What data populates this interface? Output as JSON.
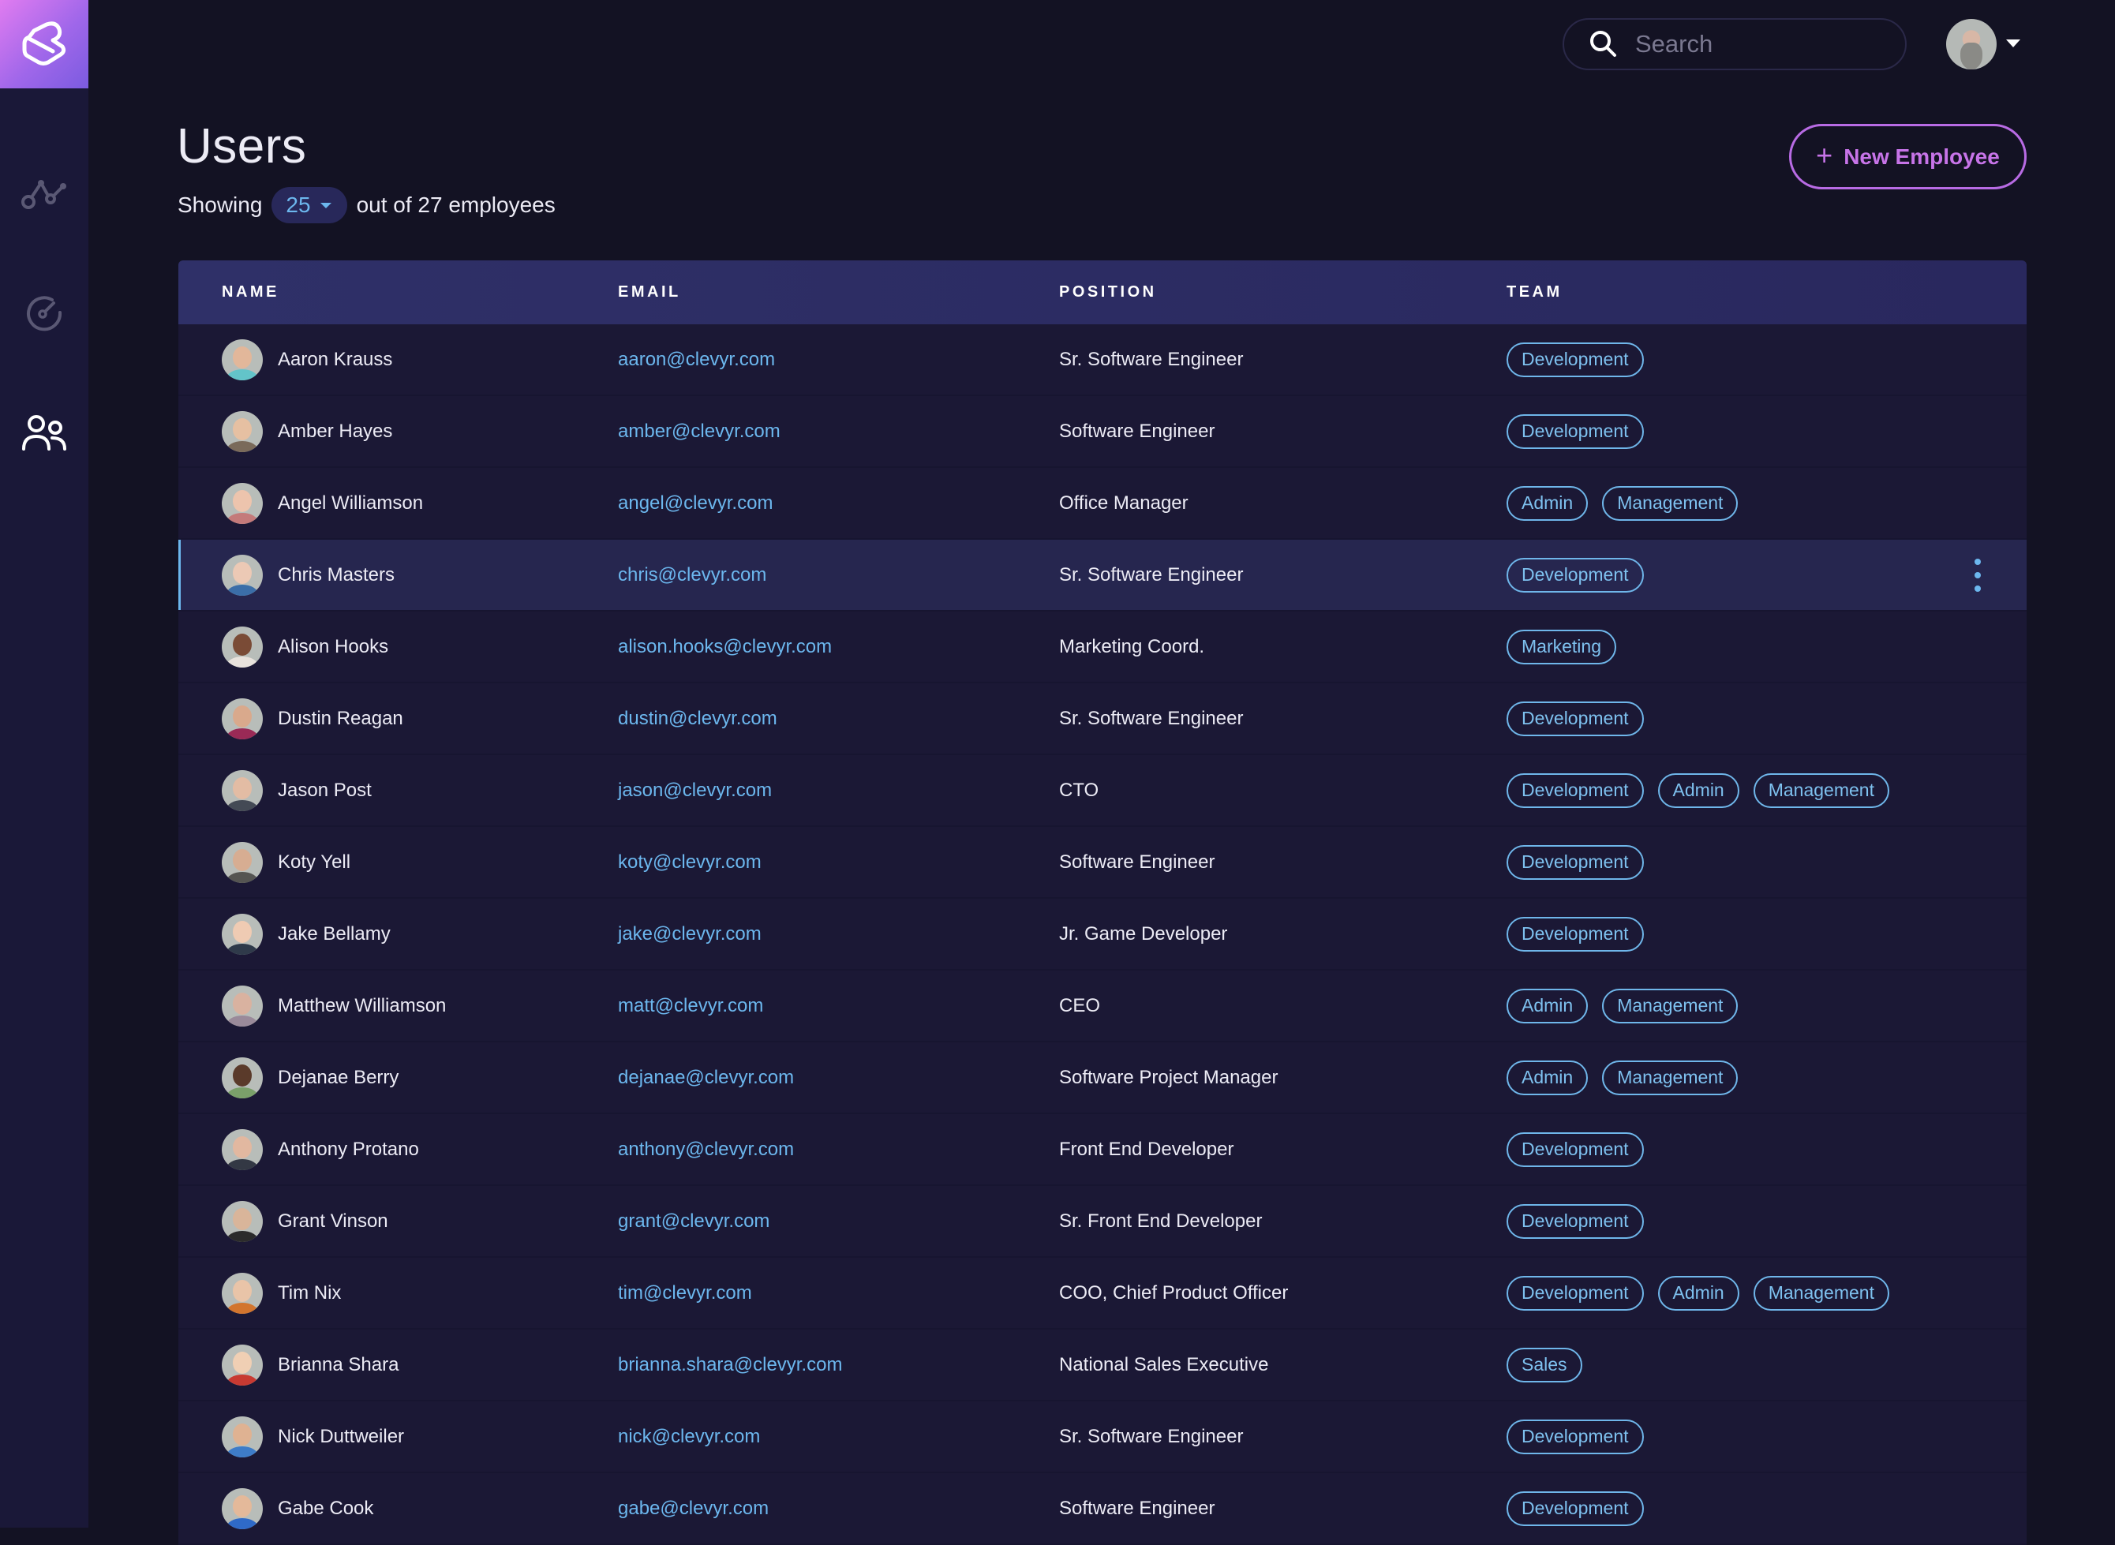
{
  "app": {
    "accent_color": "#b86be4",
    "link_color": "#6cb7ee"
  },
  "sidebar": {
    "logo": "logo-icon",
    "items": [
      {
        "name": "analytics",
        "icon": "analytics-icon",
        "active": false
      },
      {
        "name": "goals",
        "icon": "gauge-icon",
        "active": false
      },
      {
        "name": "users",
        "icon": "users-icon",
        "active": true
      }
    ]
  },
  "topbar": {
    "search": {
      "placeholder": "Search",
      "value": ""
    },
    "user_menu": {
      "icon": "caret-down-icon"
    }
  },
  "header": {
    "title": "Users",
    "showing_prefix": "Showing",
    "page_size": "25",
    "showing_suffix": "out of 27 employees",
    "new_button_label": "New Employee"
  },
  "table": {
    "columns": [
      "NAME",
      "EMAIL",
      "POSITION",
      "TEAM"
    ],
    "selected_row": 3,
    "rows": [
      {
        "name": "Aaron Krauss",
        "email": "aaron@clevyr.com",
        "position": "Sr. Software Engineer",
        "teams": [
          "Development"
        ]
      },
      {
        "name": "Amber Hayes",
        "email": "amber@clevyr.com",
        "position": "Software Engineer",
        "teams": [
          "Development"
        ]
      },
      {
        "name": "Angel Williamson",
        "email": "angel@clevyr.com",
        "position": "Office Manager",
        "teams": [
          "Admin",
          "Management"
        ]
      },
      {
        "name": "Chris Masters",
        "email": "chris@clevyr.com",
        "position": "Sr. Software Engineer",
        "teams": [
          "Development"
        ]
      },
      {
        "name": "Alison Hooks",
        "email": "alison.hooks@clevyr.com",
        "position": "Marketing Coord.",
        "teams": [
          "Marketing"
        ]
      },
      {
        "name": "Dustin Reagan",
        "email": "dustin@clevyr.com",
        "position": "Sr. Software Engineer",
        "teams": [
          "Development"
        ]
      },
      {
        "name": "Jason Post",
        "email": "jason@clevyr.com",
        "position": "CTO",
        "teams": [
          "Development",
          "Admin",
          "Management"
        ]
      },
      {
        "name": "Koty Yell",
        "email": "koty@clevyr.com",
        "position": "Software Engineer",
        "teams": [
          "Development"
        ]
      },
      {
        "name": "Jake Bellamy",
        "email": "jake@clevyr.com",
        "position": "Jr. Game Developer",
        "teams": [
          "Development"
        ]
      },
      {
        "name": "Matthew Williamson",
        "email": "matt@clevyr.com",
        "position": "CEO",
        "teams": [
          "Admin",
          "Management"
        ]
      },
      {
        "name": "Dejanae Berry",
        "email": "dejanae@clevyr.com",
        "position": "Software Project Manager",
        "teams": [
          "Admin",
          "Management"
        ]
      },
      {
        "name": "Anthony Protano",
        "email": "anthony@clevyr.com",
        "position": "Front End Developer",
        "teams": [
          "Development"
        ]
      },
      {
        "name": "Grant Vinson",
        "email": "grant@clevyr.com",
        "position": "Sr. Front End Developer",
        "teams": [
          "Development"
        ]
      },
      {
        "name": "Tim Nix",
        "email": "tim@clevyr.com",
        "position": "COO, Chief Product Officer",
        "teams": [
          "Development",
          "Admin",
          "Management"
        ]
      },
      {
        "name": "Brianna Shara",
        "email": "brianna.shara@clevyr.com",
        "position": "National Sales Executive",
        "teams": [
          "Sales"
        ]
      },
      {
        "name": "Nick Duttweiler",
        "email": "nick@clevyr.com",
        "position": "Sr. Software Engineer",
        "teams": [
          "Development"
        ]
      },
      {
        "name": "Gabe Cook",
        "email": "gabe@clevyr.com",
        "position": "Software Engineer",
        "teams": [
          "Development"
        ]
      }
    ]
  }
}
